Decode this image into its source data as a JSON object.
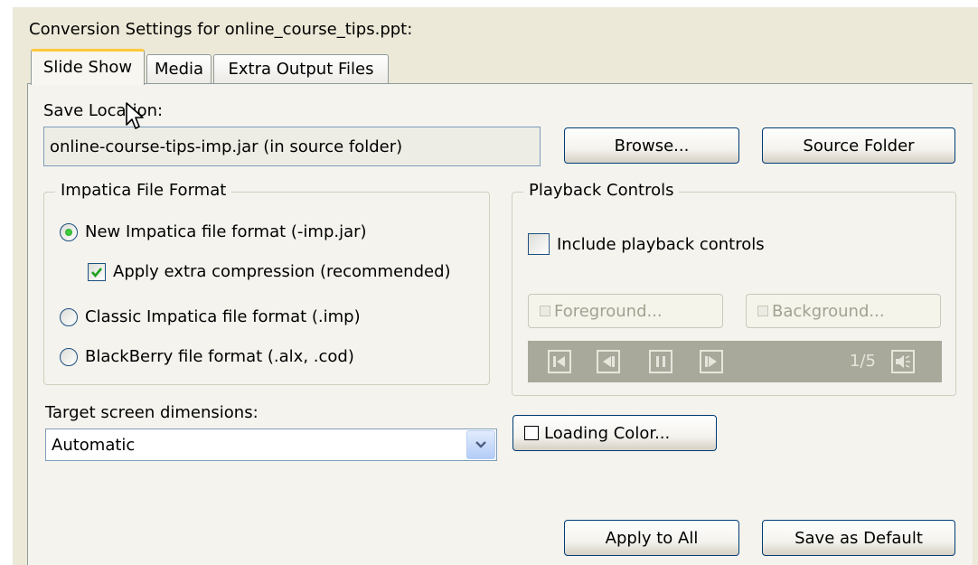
{
  "window": {
    "title": "Conversion Settings for online_course_tips.ppt:"
  },
  "tabs": [
    {
      "label": "Slide Show",
      "active": true
    },
    {
      "label": "Media",
      "active": false
    },
    {
      "label": "Extra Output Files",
      "active": false
    }
  ],
  "save_location": {
    "label": "Save Location:",
    "value": "online-course-tips-imp.jar (in source folder)",
    "browse_label": "Browse...",
    "source_folder_label": "Source Folder"
  },
  "file_format": {
    "legend": "Impatica File Format",
    "options": [
      {
        "label": "New Impatica file format (-imp.jar)",
        "selected": true
      },
      {
        "label": "Classic Impatica file format (.imp)",
        "selected": false
      },
      {
        "label": "BlackBerry file format (.alx, .cod)",
        "selected": false
      }
    ],
    "compression": {
      "label": "Apply extra compression (recommended)",
      "checked": true
    }
  },
  "playback": {
    "legend": "Playback Controls",
    "include": {
      "label": "Include playback controls",
      "checked": false
    },
    "foreground_label": "Foreground...",
    "background_label": "Background...",
    "counter": "1/5"
  },
  "target_screen": {
    "label": "Target screen dimensions:",
    "value": "Automatic"
  },
  "loading_color_label": "Loading Color...",
  "footer": {
    "apply_all_label": "Apply to All",
    "save_default_label": "Save as Default"
  },
  "colors": {
    "dialog_bg": "#ece9d8",
    "panel_bg": "#f4f3ee",
    "active_tab_accent": "#ffc83c",
    "radio_dot": "#21a121",
    "checkmark": "#21a121",
    "playback_bar": "#a8a89b"
  }
}
